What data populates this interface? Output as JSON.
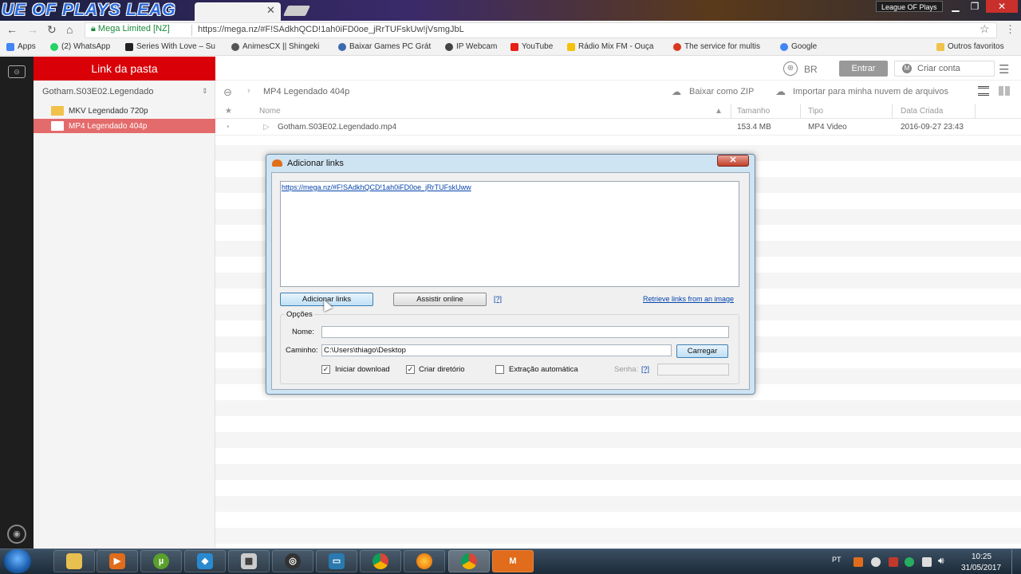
{
  "browser": {
    "watermark": "UE OF PLAYS  LEAG",
    "tab_close": "✕",
    "profile_label": "League OF Plays",
    "secure_label": "Mega Limited [NZ]",
    "url": "https://mega.nz/#F!SAdkhQCD!1ah0iFD0oe_jRrTUFskUw!jVsmgJbL",
    "bookmarks": [
      {
        "label": "Apps",
        "color": "#4285f4"
      },
      {
        "label": "(2) WhatsApp",
        "color": "#25d366"
      },
      {
        "label": "Series With Love – Su",
        "color": "#222222"
      },
      {
        "label": "AnimesCX || Shingeki",
        "color": "#555555"
      },
      {
        "label": "Baixar Games PC Grát",
        "color": "#3a6ab0"
      },
      {
        "label": "IP Webcam",
        "color": "#444444"
      },
      {
        "label": "YouTube",
        "color": "#e62117"
      },
      {
        "label": "Rádio Mix FM - Ouça",
        "color": "#f4c20d"
      },
      {
        "label": "The service for multis",
        "color": "#d9381e"
      },
      {
        "label": "Google",
        "color": "#4285f4"
      }
    ],
    "other_bookmarks": "Outros favoritos"
  },
  "mega": {
    "sidebar_title": "Link da pasta",
    "root_folder": "Gotham.S03E02.Legendado",
    "folders": [
      "MKV Legendado 720p",
      "MP4 Legendado 404p"
    ],
    "lang": "BR",
    "login": "Entrar",
    "signup": "Criar conta",
    "breadcrumb": "MP4 Legendado 404p",
    "zip_label": "Baixar como ZIP",
    "import_label": "Importar para minha nuvem de arquivos",
    "columns": {
      "name": "Nome",
      "size": "Tamanho",
      "type": "Tipo",
      "date": "Data Criada"
    },
    "files": [
      {
        "name": "Gotham.S03E02.Legendado.mp4",
        "size": "153.4 MB",
        "type": "MP4 Video",
        "date": "2016-09-27 23:43"
      }
    ]
  },
  "dialog": {
    "title": "Adicionar links",
    "close": "✕",
    "links_text": "https://mega.nz/#F!SAdkhQCD!1ah0iFD0oe_jRrTUFskUww",
    "add_links": "Adicionar links",
    "watch_online": "Assistir online",
    "help": "[?]",
    "retrieve": "Retrieve links from an image",
    "options_legend": "Opções",
    "name_label": "Nome:",
    "name_value": "",
    "path_label": "Caminho:",
    "path_value": "C:\\Users\\thiago\\Desktop",
    "browse": "Carregar",
    "start_download": "Iniciar download",
    "create_dir": "Criar diretório",
    "auto_extract": "Extração automática",
    "password_label": "Senha:",
    "help2": "[?]",
    "check_mark": "✓"
  },
  "taskbar": {
    "lang": "PT",
    "time": "10:25",
    "date": "31/05/2017",
    "apps": [
      {
        "icon": "folder-icon",
        "color": "#e8c050",
        "glyph": ""
      },
      {
        "icon": "media-player-icon",
        "color": "#e06c1c",
        "glyph": "▶"
      },
      {
        "icon": "utorrent-icon",
        "color": "#5aa02c",
        "glyph": "µ"
      },
      {
        "icon": "kodi-icon",
        "color": "#2a8ad0",
        "glyph": "◆"
      },
      {
        "icon": "building-icon",
        "color": "#cccccc",
        "glyph": "▦"
      },
      {
        "icon": "obs-icon",
        "color": "#333333",
        "glyph": "◎"
      },
      {
        "icon": "screen-recorder-icon",
        "color": "#2a7ab0",
        "glyph": "▭"
      },
      {
        "icon": "chrome-icon",
        "color": "#db4437",
        "glyph": "●"
      },
      {
        "icon": "firefox-icon",
        "color": "#e66000",
        "glyph": "●"
      },
      {
        "icon": "chrome-alt-icon",
        "color": "#db4437",
        "glyph": "●"
      },
      {
        "icon": "megasync-icon",
        "color": "#e06c1c",
        "glyph": "M"
      }
    ]
  }
}
